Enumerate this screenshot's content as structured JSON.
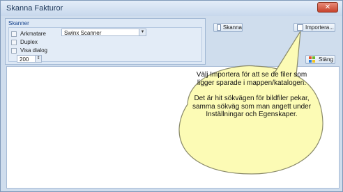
{
  "window": {
    "title": "Skanna Fakturor",
    "close_label": "✕"
  },
  "scanner_group": {
    "title": "Skanner",
    "arkmatare_label": "Arkmatare",
    "duplex_label": "Duplex",
    "visa_dialog_label": "Visa dialog",
    "scanner_select_value": "Swinx Scanner",
    "resolution_value": "200"
  },
  "buttons": {
    "skanna": "Skanna",
    "importera": "Importera...",
    "stang": "Stäng"
  },
  "callout": {
    "paragraph1": "Välj Importera för att se de filer som ligger sparade i mappen/katalogen.",
    "paragraph2": "Det är hit sökvägen för bildfiler pekar, samma sökväg som man angett under Inställningar och Egenskaper."
  }
}
